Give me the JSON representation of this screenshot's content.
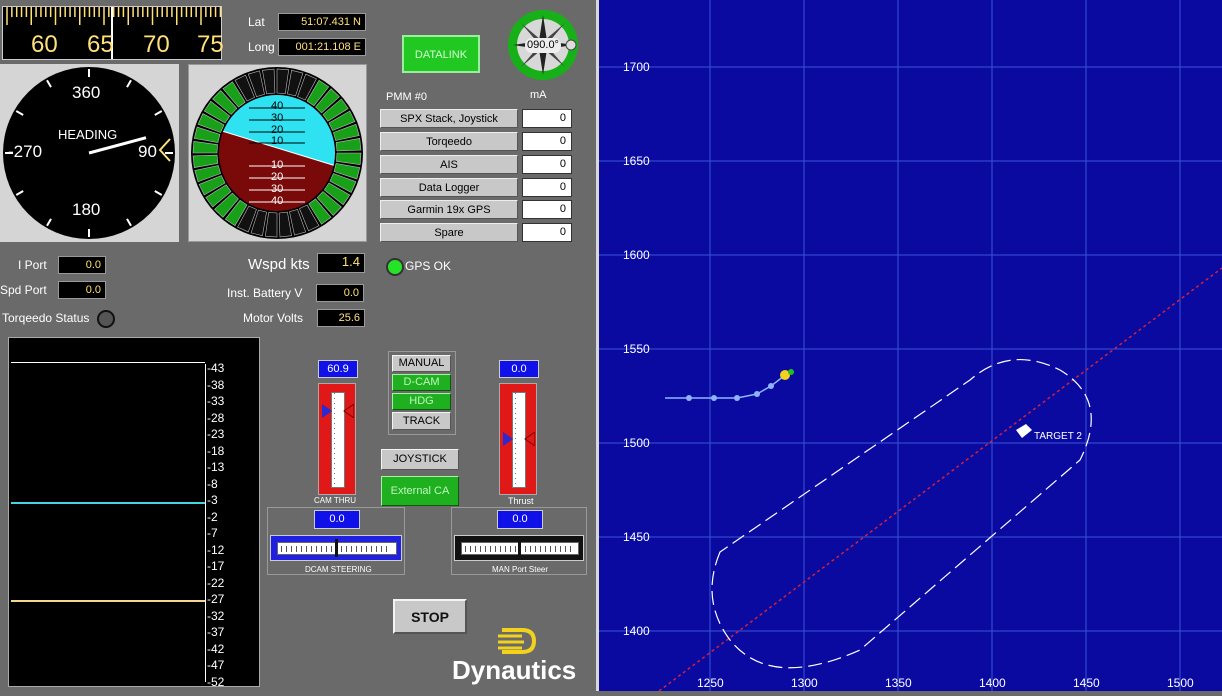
{
  "heading_tape": {
    "ticks": [
      "60",
      "65",
      "70",
      "75"
    ]
  },
  "position": {
    "lat_label": "Lat",
    "lat_value": "51:07.431 N",
    "long_label": "Long",
    "long_value": "001:21.108 E"
  },
  "datalink_button": "DATALINK",
  "compass_badge": "090.0°",
  "heading_gauge": {
    "label": "HEADING",
    "n": "360",
    "w": "-270",
    "e": "90",
    "s": "180",
    "needle_deg": 75
  },
  "attitude": {
    "upper": [
      "40",
      "30",
      "20",
      "10"
    ],
    "lower": [
      "10",
      "20",
      "30",
      "40"
    ]
  },
  "pmm": {
    "title": "PMM #0",
    "unit": "mA",
    "rows": [
      {
        "label": "SPX Stack, Joystick Modem",
        "value": "0"
      },
      {
        "label": "Torqeedo",
        "value": "0"
      },
      {
        "label": "AIS",
        "value": "0"
      },
      {
        "label": "Data Logger",
        "value": "0"
      },
      {
        "label": "Garmin 19x GPS",
        "value": "0"
      },
      {
        "label": "Spare",
        "value": "0"
      }
    ]
  },
  "gps_status": "GPS OK",
  "readouts": {
    "i_port_label": "I Port",
    "i_port_value": "0.0",
    "spd_port_label": "Spd Port",
    "spd_port_value": "0.0",
    "torqeedo_status_label": "Torqeedo Status",
    "wspd_label": "Wspd kts",
    "wspd_value": "1.4",
    "battery_label": "Inst. Battery V",
    "battery_value": "0.0",
    "motor_label": "Motor Volts",
    "motor_value": "25.6"
  },
  "scale": {
    "labels": [
      "-43",
      "-38",
      "-33",
      "-28",
      "-23",
      "-18",
      "-13",
      "-8",
      "-3",
      "2",
      "7",
      "12",
      "17",
      "22",
      "27",
      "32",
      "37",
      "42",
      "47",
      "52"
    ]
  },
  "modes": {
    "manual": "MANUAL",
    "dcam": "D-CAM",
    "hdg": "HDG",
    "track": "TRACK",
    "joystick": "JOYSTICK",
    "external_ca": "External CA"
  },
  "dcam_thrust": {
    "value": "60.9",
    "label": "CAM THRU"
  },
  "thrust": {
    "value": "0.0",
    "label": "Thrust"
  },
  "dcam_steering": {
    "value": "0.0",
    "label": "DCAM STEERING"
  },
  "man_steer": {
    "value": "0.0",
    "label": "MAN Port Steer"
  },
  "stop_button": "STOP",
  "brand": "Dynautics",
  "map": {
    "y_ticks": [
      "1700",
      "1650",
      "1600",
      "1550",
      "1500",
      "1450",
      "1400"
    ],
    "x_ticks": [
      "1250",
      "1300",
      "1350",
      "1400",
      "1450",
      "1500"
    ],
    "target_label": "TARGET 2",
    "colors": {
      "background": "#0a0aa0",
      "grid": "#3a52d8",
      "track_line": "#d02040",
      "waypoint_path": "#ffffff"
    }
  }
}
